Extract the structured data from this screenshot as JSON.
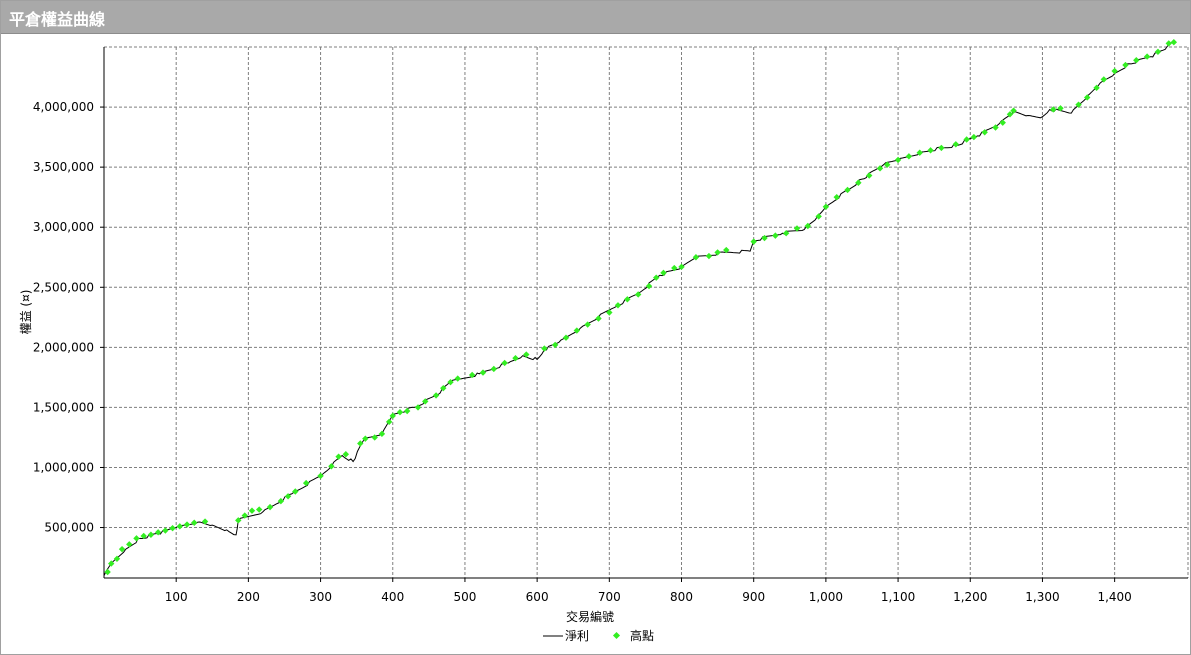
{
  "window": {
    "title": "平倉權益曲線"
  },
  "chart_data": {
    "type": "line",
    "title": "",
    "xlabel": "交易編號",
    "ylabel": "權益 (¤)",
    "xlim": [
      0,
      1485
    ],
    "ylim": [
      80000,
      4500000
    ],
    "x_ticks": [
      100,
      200,
      300,
      400,
      500,
      600,
      700,
      800,
      900,
      1000,
      1100,
      1200,
      1300,
      1400
    ],
    "x_tick_labels": [
      "100",
      "200",
      "300",
      "400",
      "500",
      "600",
      "700",
      "800",
      "900",
      "1,000",
      "1,100",
      "1,200",
      "1,300",
      "1,400"
    ],
    "y_ticks": [
      500000,
      1000000,
      1500000,
      2000000,
      2500000,
      3000000,
      3500000,
      4000000
    ],
    "y_tick_labels": [
      "500,000",
      "1,000,000",
      "1,500,000",
      "2,000,000",
      "2,500,000",
      "3,000,000",
      "3,500,000",
      "4,000,000"
    ],
    "grid": true,
    "legend_position": "bottom-center",
    "colors": {
      "line": "#000000",
      "markers": "#33ee22",
      "grid": "#7f7f7f"
    },
    "series": [
      {
        "name": "淨利",
        "kind": "line",
        "points": [
          [
            0,
            100000
          ],
          [
            10,
            200000
          ],
          [
            30,
            320000
          ],
          [
            50,
            410000
          ],
          [
            75,
            450000
          ],
          [
            100,
            500000
          ],
          [
            130,
            545000
          ],
          [
            150,
            520000
          ],
          [
            170,
            480000
          ],
          [
            183,
            440000
          ],
          [
            186,
            560000
          ],
          [
            220,
            630000
          ],
          [
            260,
            780000
          ],
          [
            300,
            930000
          ],
          [
            330,
            1100000
          ],
          [
            345,
            1050000
          ],
          [
            360,
            1230000
          ],
          [
            385,
            1280000
          ],
          [
            400,
            1440000
          ],
          [
            430,
            1500000
          ],
          [
            460,
            1600000
          ],
          [
            480,
            1710000
          ],
          [
            520,
            1780000
          ],
          [
            560,
            1870000
          ],
          [
            580,
            1930000
          ],
          [
            600,
            1900000
          ],
          [
            610,
            1980000
          ],
          [
            630,
            2040000
          ],
          [
            660,
            2160000
          ],
          [
            700,
            2310000
          ],
          [
            740,
            2450000
          ],
          [
            770,
            2600000
          ],
          [
            800,
            2660000
          ],
          [
            820,
            2750000
          ],
          [
            860,
            2790000
          ],
          [
            895,
            2800000
          ],
          [
            900,
            2890000
          ],
          [
            940,
            2950000
          ],
          [
            970,
            2980000
          ],
          [
            985,
            3060000
          ],
          [
            1000,
            3170000
          ],
          [
            1030,
            3310000
          ],
          [
            1050,
            3400000
          ],
          [
            1080,
            3520000
          ],
          [
            1100,
            3560000
          ],
          [
            1130,
            3620000
          ],
          [
            1160,
            3660000
          ],
          [
            1180,
            3680000
          ],
          [
            1210,
            3760000
          ],
          [
            1240,
            3860000
          ],
          [
            1260,
            3960000
          ],
          [
            1280,
            3930000
          ],
          [
            1300,
            3920000
          ],
          [
            1310,
            3980000
          ],
          [
            1340,
            3950000
          ],
          [
            1360,
            4070000
          ],
          [
            1380,
            4200000
          ],
          [
            1400,
            4280000
          ],
          [
            1420,
            4360000
          ],
          [
            1450,
            4420000
          ],
          [
            1470,
            4480000
          ],
          [
            1480,
            4540000
          ]
        ]
      },
      {
        "name": "高點",
        "kind": "scatter",
        "points": [
          [
            5,
            130000
          ],
          [
            10,
            200000
          ],
          [
            18,
            240000
          ],
          [
            25,
            320000
          ],
          [
            35,
            360000
          ],
          [
            45,
            410000
          ],
          [
            55,
            430000
          ],
          [
            65,
            440000
          ],
          [
            75,
            460000
          ],
          [
            85,
            475000
          ],
          [
            95,
            495000
          ],
          [
            105,
            510000
          ],
          [
            115,
            525000
          ],
          [
            125,
            540000
          ],
          [
            140,
            550000
          ],
          [
            186,
            560000
          ],
          [
            195,
            600000
          ],
          [
            205,
            640000
          ],
          [
            215,
            650000
          ],
          [
            230,
            670000
          ],
          [
            245,
            720000
          ],
          [
            255,
            760000
          ],
          [
            265,
            800000
          ],
          [
            280,
            870000
          ],
          [
            300,
            930000
          ],
          [
            315,
            1010000
          ],
          [
            325,
            1090000
          ],
          [
            335,
            1110000
          ],
          [
            355,
            1200000
          ],
          [
            362,
            1240000
          ],
          [
            375,
            1250000
          ],
          [
            385,
            1280000
          ],
          [
            395,
            1380000
          ],
          [
            400,
            1430000
          ],
          [
            410,
            1460000
          ],
          [
            420,
            1470000
          ],
          [
            435,
            1500000
          ],
          [
            445,
            1550000
          ],
          [
            460,
            1600000
          ],
          [
            470,
            1660000
          ],
          [
            480,
            1710000
          ],
          [
            490,
            1740000
          ],
          [
            510,
            1770000
          ],
          [
            525,
            1790000
          ],
          [
            540,
            1820000
          ],
          [
            555,
            1870000
          ],
          [
            570,
            1910000
          ],
          [
            585,
            1940000
          ],
          [
            610,
            1990000
          ],
          [
            625,
            2020000
          ],
          [
            640,
            2080000
          ],
          [
            655,
            2140000
          ],
          [
            670,
            2190000
          ],
          [
            685,
            2240000
          ],
          [
            700,
            2290000
          ],
          [
            712,
            2350000
          ],
          [
            725,
            2400000
          ],
          [
            740,
            2440000
          ],
          [
            755,
            2510000
          ],
          [
            765,
            2580000
          ],
          [
            775,
            2620000
          ],
          [
            790,
            2660000
          ],
          [
            800,
            2670000
          ],
          [
            820,
            2750000
          ],
          [
            838,
            2760000
          ],
          [
            850,
            2790000
          ],
          [
            862,
            2810000
          ],
          [
            900,
            2880000
          ],
          [
            915,
            2910000
          ],
          [
            930,
            2930000
          ],
          [
            945,
            2950000
          ],
          [
            960,
            2990000
          ],
          [
            975,
            3010000
          ],
          [
            990,
            3090000
          ],
          [
            1000,
            3170000
          ],
          [
            1015,
            3250000
          ],
          [
            1030,
            3310000
          ],
          [
            1045,
            3370000
          ],
          [
            1060,
            3430000
          ],
          [
            1075,
            3490000
          ],
          [
            1085,
            3520000
          ],
          [
            1100,
            3560000
          ],
          [
            1115,
            3590000
          ],
          [
            1130,
            3620000
          ],
          [
            1145,
            3640000
          ],
          [
            1160,
            3660000
          ],
          [
            1180,
            3690000
          ],
          [
            1195,
            3730000
          ],
          [
            1205,
            3750000
          ],
          [
            1220,
            3790000
          ],
          [
            1235,
            3830000
          ],
          [
            1245,
            3870000
          ],
          [
            1255,
            3940000
          ],
          [
            1260,
            3970000
          ],
          [
            1315,
            3980000
          ],
          [
            1325,
            3990000
          ],
          [
            1350,
            4020000
          ],
          [
            1362,
            4080000
          ],
          [
            1375,
            4160000
          ],
          [
            1385,
            4230000
          ],
          [
            1400,
            4300000
          ],
          [
            1415,
            4350000
          ],
          [
            1430,
            4390000
          ],
          [
            1445,
            4420000
          ],
          [
            1460,
            4460000
          ],
          [
            1475,
            4530000
          ],
          [
            1482,
            4540000
          ]
        ]
      }
    ]
  }
}
